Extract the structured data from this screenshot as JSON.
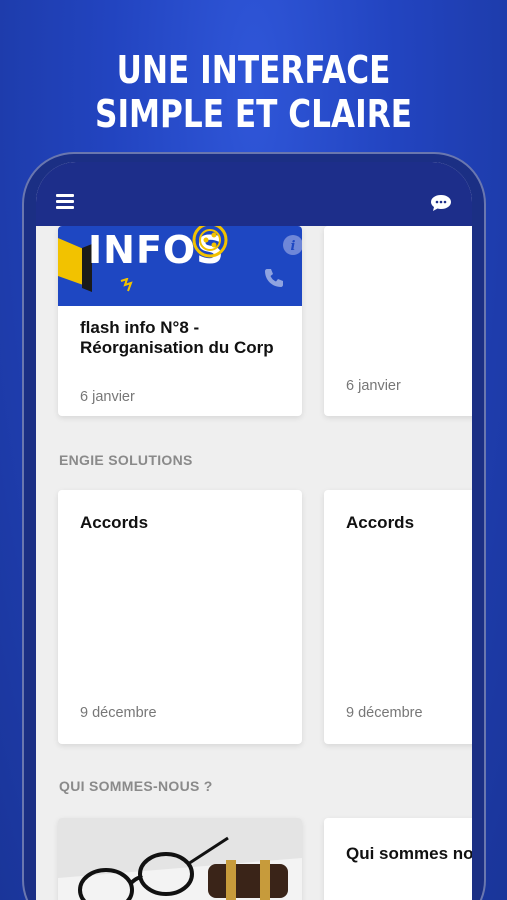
{
  "headline": {
    "line1": "UNE INTERFACE",
    "line2": "SIMPLE ET CLAIRE"
  },
  "appbar": {
    "menu_icon": "hamburger-menu-icon",
    "chat_icon": "chat-bubble-icon"
  },
  "news": {
    "cards": [
      {
        "banner_text": "INFOS",
        "title": "flash info N°8 - Réorganisation du Corp",
        "date": "6 janvier"
      },
      {
        "title": "",
        "date": "6 janvier"
      }
    ]
  },
  "sections": [
    {
      "title": "ENGIE SOLUTIONS",
      "cards": [
        {
          "title": "Accords",
          "date": "9 décembre"
        },
        {
          "title": "Accords",
          "date": "9 décembre"
        }
      ]
    },
    {
      "title": "QUI SOMMES-NOUS ?",
      "cards": [
        {
          "title": ""
        },
        {
          "title": "Qui sommes nous"
        }
      ]
    }
  ],
  "colors": {
    "background": "#2244c0",
    "appbar": "#1d2e8a",
    "banner": "#1e47c2",
    "accent_yellow": "#f2c200"
  }
}
